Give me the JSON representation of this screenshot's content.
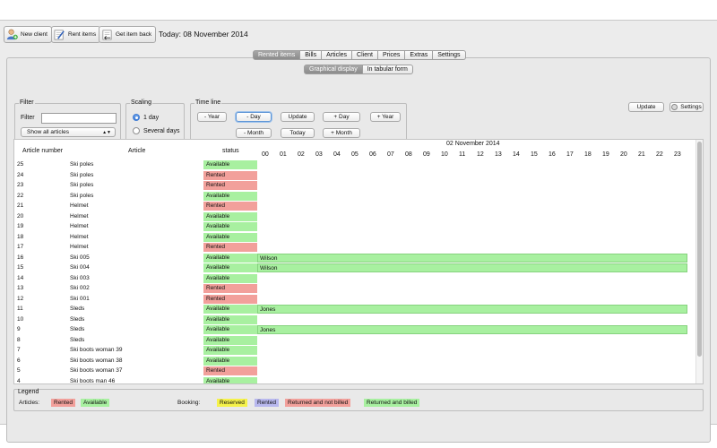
{
  "toolbar": {
    "new_client": "New client",
    "rent_items": "Rent items",
    "get_item_back": "Get item back",
    "today": "Today: 08 November 2014"
  },
  "tabs": [
    "Rented items",
    "Bills",
    "Articles",
    "Client",
    "Prices",
    "Extras",
    "Settings"
  ],
  "subtabs": [
    "Graphical display",
    "In tabular form"
  ],
  "filter": {
    "title": "Filter",
    "label": "Filter",
    "value": "",
    "select_value": "Show all articles"
  },
  "scaling": {
    "title": "Scaling",
    "options": [
      "1 day",
      "Several days"
    ],
    "selected": "1 day"
  },
  "timeline": {
    "title": "Time line",
    "buttons_row1": [
      "- Year",
      "- Day",
      "Update",
      "+ Day",
      "+ Year"
    ],
    "buttons_row2": [
      "- Month",
      "Today",
      "+ Month"
    ]
  },
  "right": {
    "update": "Update",
    "settings": "Settings"
  },
  "table": {
    "headers": {
      "article_number": "Article number",
      "article": "Article",
      "status": "status",
      "date": "02 November 2014"
    },
    "hours": [
      "00",
      "01",
      "02",
      "03",
      "04",
      "05",
      "06",
      "07",
      "08",
      "09",
      "10",
      "11",
      "12",
      "13",
      "14",
      "15",
      "16",
      "17",
      "18",
      "19",
      "20",
      "21",
      "22",
      "23"
    ],
    "rows": [
      {
        "num": "25",
        "article": "Ski poles",
        "status": "Available",
        "booking": ""
      },
      {
        "num": "24",
        "article": "Ski poles",
        "status": "Rented",
        "booking": ""
      },
      {
        "num": "23",
        "article": "Ski poles",
        "status": "Rented",
        "booking": ""
      },
      {
        "num": "22",
        "article": "Ski poles",
        "status": "Available",
        "booking": ""
      },
      {
        "num": "21",
        "article": "Helmet",
        "status": "Rented",
        "booking": ""
      },
      {
        "num": "20",
        "article": "Helmet",
        "status": "Available",
        "booking": ""
      },
      {
        "num": "19",
        "article": "Helmet",
        "status": "Available",
        "booking": ""
      },
      {
        "num": "18",
        "article": "Helmet",
        "status": "Available",
        "booking": ""
      },
      {
        "num": "17",
        "article": "Helmet",
        "status": "Rented",
        "booking": ""
      },
      {
        "num": "16",
        "article": "Ski 005",
        "status": "Available",
        "booking": "Wilson"
      },
      {
        "num": "15",
        "article": "Ski 004",
        "status": "Available",
        "booking": "Wilson"
      },
      {
        "num": "14",
        "article": "Ski 003",
        "status": "Available",
        "booking": ""
      },
      {
        "num": "13",
        "article": "Ski 002",
        "status": "Rented",
        "booking": ""
      },
      {
        "num": "12",
        "article": "Ski 001",
        "status": "Rented",
        "booking": ""
      },
      {
        "num": "11",
        "article": "Sleds",
        "status": "Available",
        "booking": "Jones"
      },
      {
        "num": "10",
        "article": "Sleds",
        "status": "Available",
        "booking": ""
      },
      {
        "num": "9",
        "article": "Sleds",
        "status": "Available",
        "booking": "Jones"
      },
      {
        "num": "8",
        "article": "Sleds",
        "status": "Available",
        "booking": ""
      },
      {
        "num": "7",
        "article": "Ski boots woman 39",
        "status": "Available",
        "booking": ""
      },
      {
        "num": "6",
        "article": "Ski boots woman 38",
        "status": "Available",
        "booking": ""
      },
      {
        "num": "5",
        "article": "Ski boots woman 37",
        "status": "Rented",
        "booking": ""
      },
      {
        "num": "4",
        "article": "Ski boots man 46",
        "status": "Available",
        "booking": ""
      }
    ]
  },
  "legend": {
    "title": "Legend",
    "articles_label": "Articles:",
    "articles": [
      {
        "label": "Rented",
        "color": "#f2a09b"
      },
      {
        "label": "Available",
        "color": "#a8f0a0"
      }
    ],
    "booking_label": "Booking:",
    "booking": [
      {
        "label": "Reserved",
        "color": "#f5f24a"
      },
      {
        "label": "Rented",
        "color": "#b8b8ee"
      },
      {
        "label": "Returned and not billed",
        "color": "#f2a09b"
      },
      {
        "label": "Returned and billed",
        "color": "#a8f0a0"
      }
    ]
  }
}
